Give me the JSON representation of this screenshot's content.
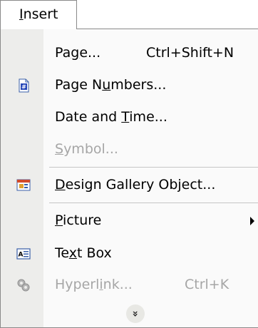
{
  "menubar": {
    "tab_label_pre": "",
    "tab_label_key": "I",
    "tab_label_post": "nsert"
  },
  "menu": {
    "items": [
      {
        "pre": "Pa",
        "key": "g",
        "post": "e...",
        "shortcut": "Ctrl+Shift+N",
        "icon": "",
        "enabled": true
      },
      {
        "pre": "Page N",
        "key": "u",
        "post": "mbers...",
        "shortcut": "",
        "icon": "page-numbers-icon",
        "enabled": true
      },
      {
        "pre": "Date and ",
        "key": "T",
        "post": "ime...",
        "shortcut": "",
        "icon": "",
        "enabled": true
      },
      {
        "pre": "",
        "key": "S",
        "post": "ymbol...",
        "shortcut": "",
        "icon": "",
        "enabled": false
      },
      {
        "pre": "",
        "key": "D",
        "post": "esign Gallery Object...",
        "shortcut": "",
        "icon": "design-gallery-icon",
        "enabled": true
      },
      {
        "pre": "",
        "key": "P",
        "post": "icture",
        "shortcut": "",
        "icon": "",
        "enabled": true,
        "submenu": true
      },
      {
        "pre": "Te",
        "key": "x",
        "post": "t Box",
        "shortcut": "",
        "icon": "text-box-icon",
        "enabled": true
      },
      {
        "pre": "Hyperl",
        "key": "i",
        "post": "nk...",
        "shortcut": "Ctrl+K",
        "icon": "hyperlink-icon",
        "enabled": false
      }
    ],
    "expand_glyph": "»"
  },
  "colors": {
    "icon_strip": "#ededeb",
    "menu_background": "#fafafa",
    "disabled_text": "#a6a6a6",
    "border": "#8a8a8a"
  }
}
